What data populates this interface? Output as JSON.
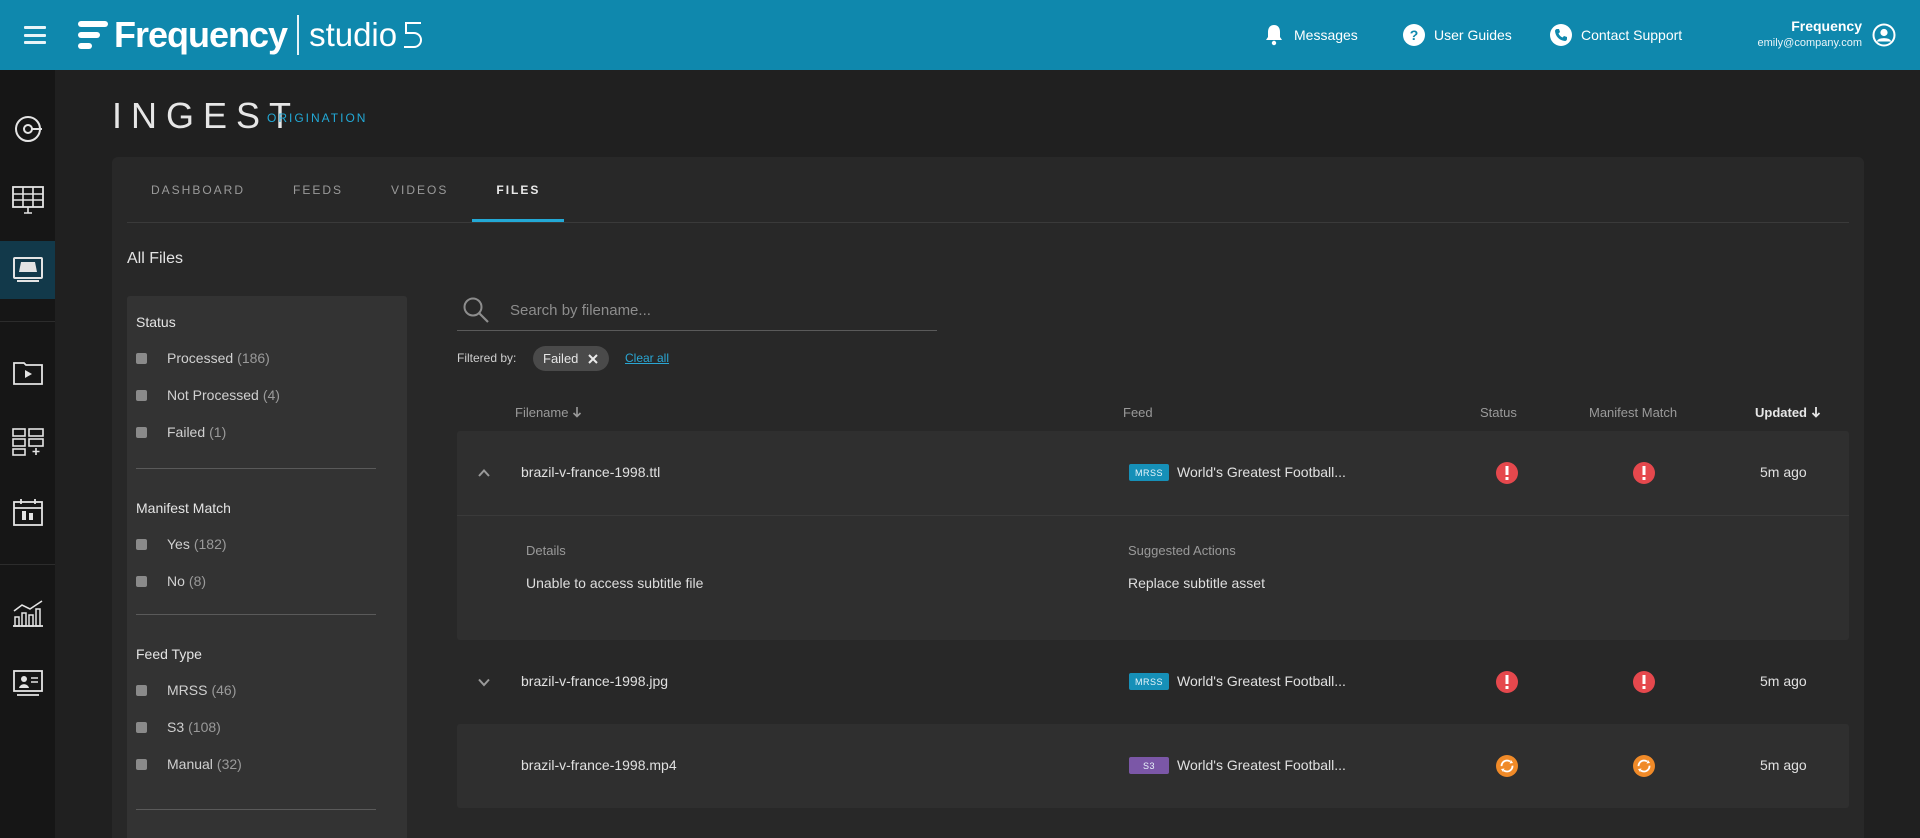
{
  "brand": {
    "name": "Frequency",
    "product": "studio"
  },
  "topnav": {
    "messages": "Messages",
    "user_guides": "User Guides",
    "contact_support": "Contact Support"
  },
  "user": {
    "name": "Frequency",
    "email": "emily@company.com"
  },
  "rail": {
    "items": [
      "origination-icon",
      "grid-icon",
      "ingest-icon",
      "video-library-icon",
      "playlist-icon",
      "schedule-icon",
      "analytics-icon",
      "presenter-icon"
    ],
    "active_index": 2
  },
  "page": {
    "title": "INGEST",
    "subtitle": "ORIGINATION"
  },
  "tabs": [
    {
      "label": "DASHBOARD",
      "active": false
    },
    {
      "label": "FEEDS",
      "active": false
    },
    {
      "label": "VIDEOS",
      "active": false
    },
    {
      "label": "FILES",
      "active": true
    }
  ],
  "section_title": "All Files",
  "filters": {
    "status": {
      "title": "Status",
      "options": [
        {
          "label": "Processed",
          "count": "(186)"
        },
        {
          "label": "Not Processed",
          "count": "(4)"
        },
        {
          "label": "Failed",
          "count": "(1)"
        }
      ]
    },
    "manifest": {
      "title": "Manifest Match",
      "options": [
        {
          "label": "Yes",
          "count": "(182)"
        },
        {
          "label": "No",
          "count": "(8)"
        }
      ]
    },
    "feed_type": {
      "title": "Feed Type",
      "options": [
        {
          "label": "MRSS",
          "count": "(46)"
        },
        {
          "label": "S3",
          "count": "(108)"
        },
        {
          "label": "Manual",
          "count": "(32)"
        }
      ]
    }
  },
  "search": {
    "placeholder": "Search by filename..."
  },
  "filtered_by": {
    "label": "Filtered by:",
    "chip": "Failed",
    "clear": "Clear all"
  },
  "table": {
    "headers": {
      "filename": "Filename",
      "feed": "Feed",
      "status": "Status",
      "manifest": "Manifest Match",
      "updated": "Updated"
    },
    "rows": [
      {
        "filename": "brazil-v-france-1998.ttl",
        "feed_type": "MRSS",
        "feed": "World's Greatest Football...",
        "status": "error",
        "manifest": "error",
        "updated": "5m ago",
        "expanded": true
      },
      {
        "filename": "brazil-v-france-1998.jpg",
        "feed_type": "MRSS",
        "feed": "World's Greatest Football...",
        "status": "error",
        "manifest": "error",
        "updated": "5m ago",
        "expanded": false
      },
      {
        "filename": "brazil-v-france-1998.mp4",
        "feed_type": "S3",
        "feed": "World's Greatest Football...",
        "status": "processing",
        "manifest": "processing",
        "updated": "5m ago",
        "expanded": false
      }
    ],
    "detail": {
      "details_label": "Details",
      "details_value": "Unable to access subtitle file",
      "actions_label": "Suggested Actions",
      "actions_value": "Replace subtitle asset"
    }
  },
  "colors": {
    "topbar": "#0f88ad",
    "accent": "#23a9d6",
    "error": "#e5484d",
    "processing": "#f08a28",
    "mrss": "#1690b8",
    "s3": "#7b57a7"
  }
}
